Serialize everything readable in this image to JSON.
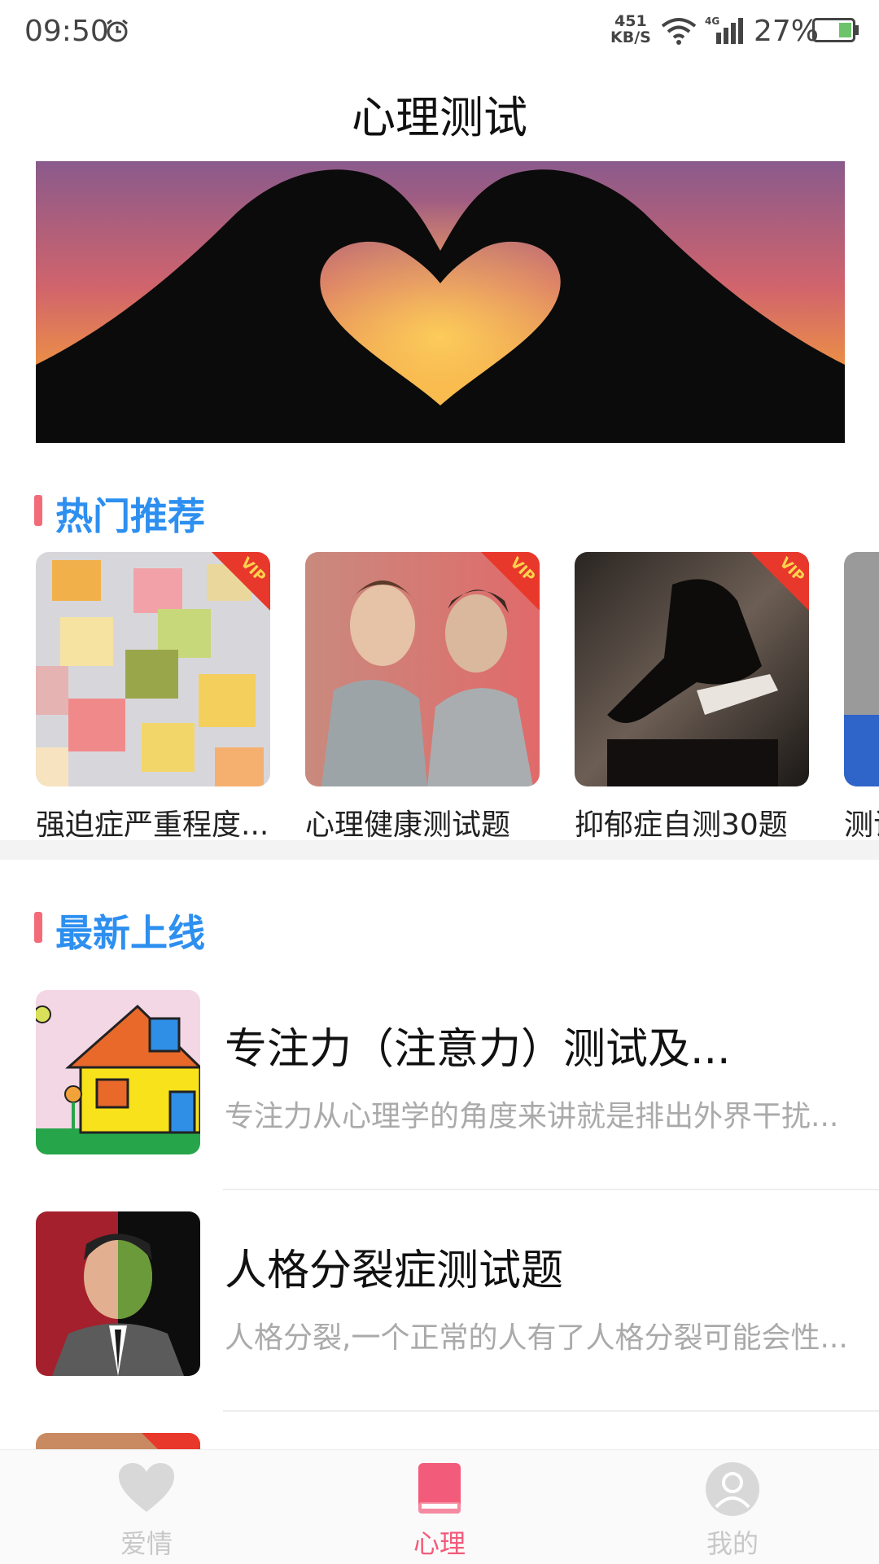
{
  "status_bar": {
    "time": "09:50",
    "net_speed_value": "451",
    "net_speed_unit": "KB/S",
    "network": "4G",
    "battery": "27%"
  },
  "header": {
    "title": "心理测试"
  },
  "hot": {
    "title": "热门推荐",
    "badge": "VIP",
    "items": [
      {
        "label": "强迫症严重程度...",
        "vip": true
      },
      {
        "label": "心理健康测试题",
        "vip": true
      },
      {
        "label": "抑郁症自测30题",
        "vip": true
      },
      {
        "label": "测试",
        "vip": false
      }
    ]
  },
  "latest": {
    "title": "最新上线",
    "items": [
      {
        "title": "专注力（注意力）测试及...",
        "desc": "专注力从心理学的角度来讲就是排出外界干扰..."
      },
      {
        "title": "人格分裂症测试题",
        "desc": "人格分裂,一个正常的人有了人格分裂可能会性..."
      }
    ]
  },
  "tabs": [
    {
      "label": "爱情",
      "active": false,
      "icon": "heart-icon"
    },
    {
      "label": "心理",
      "active": true,
      "icon": "book-icon"
    },
    {
      "label": "我的",
      "active": false,
      "icon": "user-icon"
    }
  ],
  "colors": {
    "accent": "#2d8ff0",
    "marker": "#f36b78",
    "active_tab": "#f35b7a"
  }
}
